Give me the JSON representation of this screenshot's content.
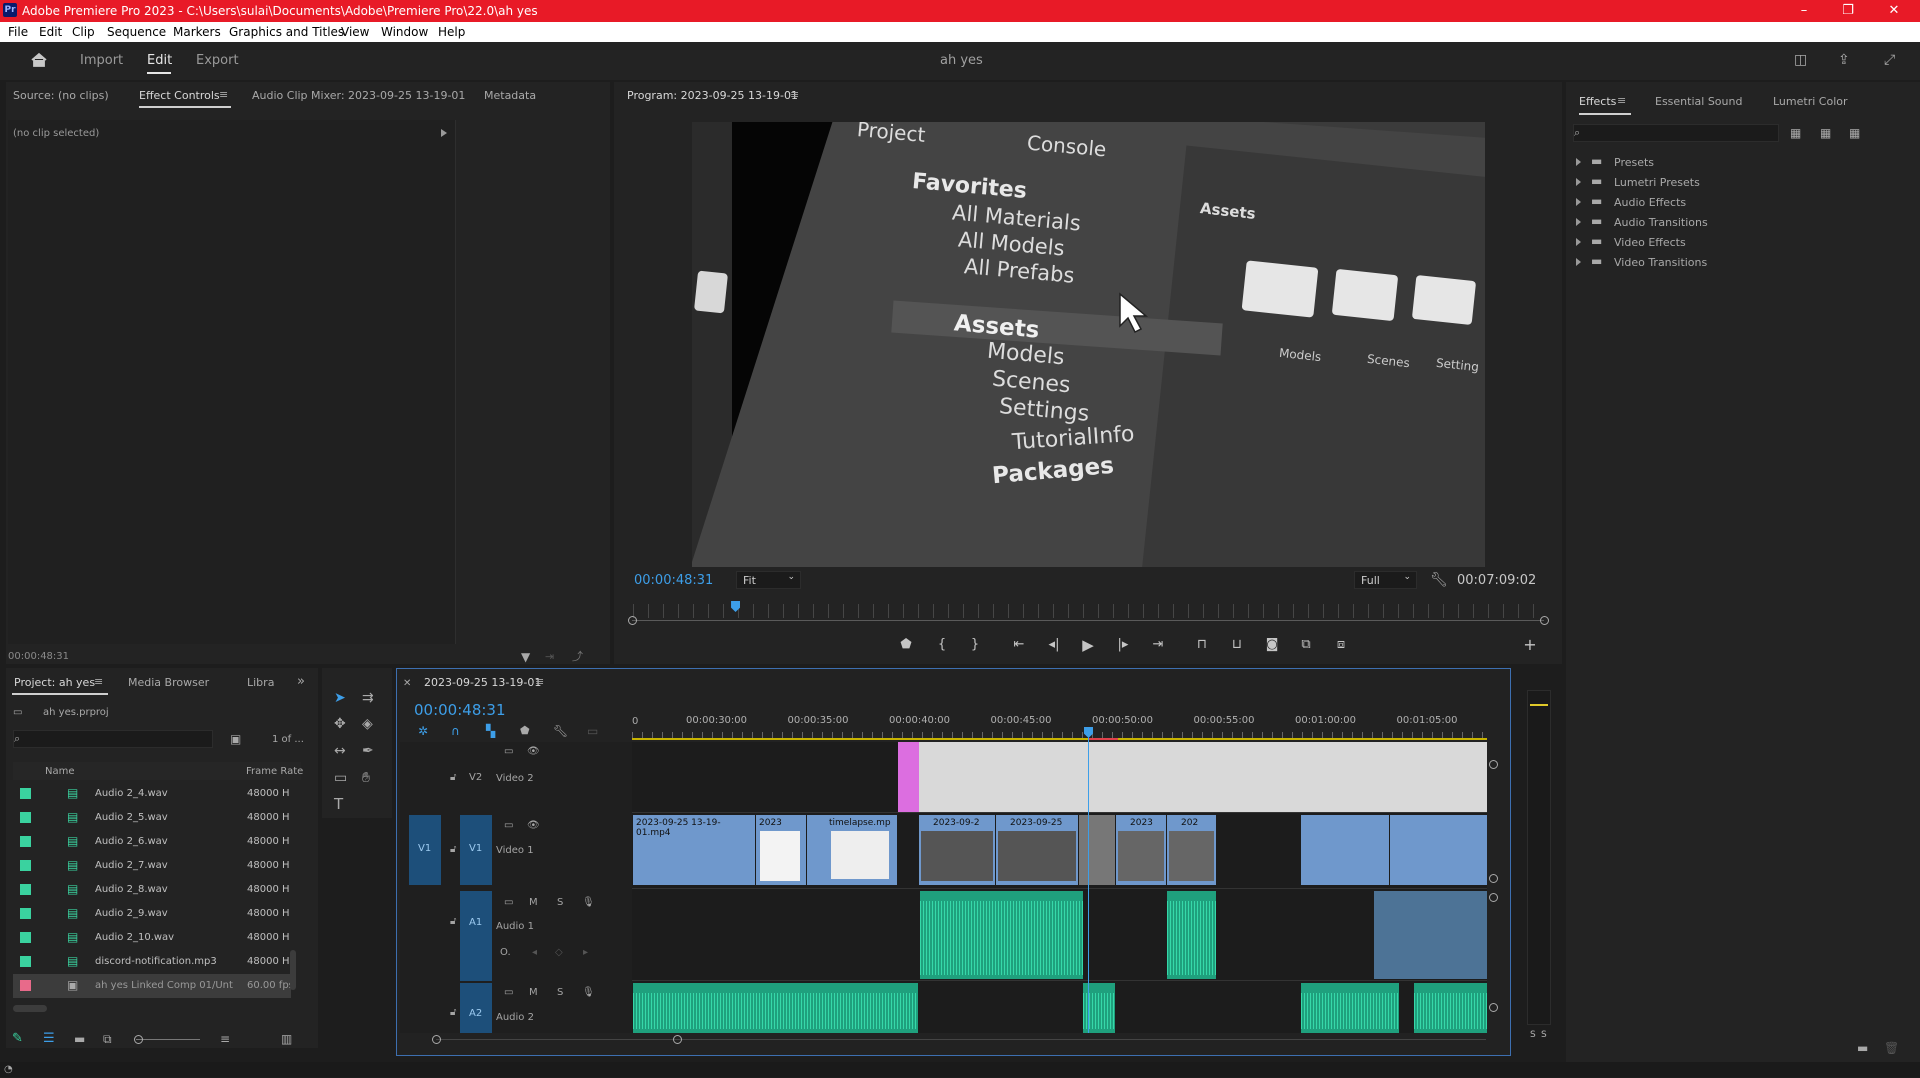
{
  "window": {
    "title": "Adobe Premiere Pro 2023 - C:\\Users\\sulai\\Documents\\Adobe\\Premiere Pro\\22.0\\ah yes",
    "app_badge": "Pr",
    "minimize": "–",
    "restore": "❐",
    "close": "✕"
  },
  "menu": [
    "File",
    "Edit",
    "Clip",
    "Sequence",
    "Markers",
    "Graphics and Titles",
    "View",
    "Window",
    "Help"
  ],
  "workspace": {
    "tabs": [
      "Import",
      "Edit",
      "Export"
    ],
    "active": "Edit",
    "project_name": "ah yes"
  },
  "source_panel": {
    "tabs": [
      "Source: (no clips)",
      "Effect Controls",
      "Audio Clip Mixer: 2023-09-25 13-19-01",
      "Metadata"
    ],
    "active": "Effect Controls",
    "no_clip": "(no clip selected)",
    "timecode": "00:00:48:31"
  },
  "program": {
    "title": "Program: 2023-09-25 13-19-01",
    "timecode": "00:00:48:31",
    "fit": "Fit",
    "quality": "Full",
    "duration": "00:07:09:02",
    "playhead_fraction": 0.113
  },
  "video_frame": {
    "labels": {
      "project": "Project",
      "console": "Console",
      "favorites": "Favorites",
      "all_materials": "All Materials",
      "all_models": "All Models",
      "all_prefabs": "All Prefabs",
      "assets": "Assets",
      "models": "Models",
      "scenes": "Scenes",
      "settings": "Settings",
      "tutorialinfo": "TutorialInfo",
      "packages": "Packages",
      "assets_header": "Assets",
      "grid_models": "Models",
      "grid_scenes": "Scenes",
      "grid_settings": "Setting"
    }
  },
  "effects_panel": {
    "tabs": [
      "Effects",
      "Essential Sound",
      "Lumetri Color"
    ],
    "active": "Effects",
    "items": [
      "Presets",
      "Lumetri Presets",
      "Audio Effects",
      "Audio Transitions",
      "Video Effects",
      "Video Transitions"
    ]
  },
  "project_panel": {
    "tabs": [
      "Project: ah yes",
      "Media Browser",
      "Libra"
    ],
    "file": "ah yes.prproj",
    "count": "1 of ...",
    "col_name": "Name",
    "col_rate": "Frame Rate",
    "items": [
      {
        "name": "Audio 2_4.wav",
        "rate": "48000 H",
        "color": "#3ad29f"
      },
      {
        "name": "Audio 2_5.wav",
        "rate": "48000 H",
        "color": "#3ad29f"
      },
      {
        "name": "Audio 2_6.wav",
        "rate": "48000 H",
        "color": "#3ad29f"
      },
      {
        "name": "Audio 2_7.wav",
        "rate": "48000 H",
        "color": "#3ad29f"
      },
      {
        "name": "Audio 2_8.wav",
        "rate": "48000 H",
        "color": "#3ad29f"
      },
      {
        "name": "Audio 2_9.wav",
        "rate": "48000 H",
        "color": "#3ad29f"
      },
      {
        "name": "Audio 2_10.wav",
        "rate": "48000 H",
        "color": "#3ad29f"
      },
      {
        "name": "discord-notification.mp3",
        "rate": "48000 H",
        "color": "#3ad29f"
      },
      {
        "name": "ah yes Linked Comp 01/Unt",
        "rate": "60.00 fps",
        "color": "#e86a8a"
      }
    ]
  },
  "timeline": {
    "sequence": "2023-09-25 13-19-01",
    "timecode": "00:00:48:31",
    "ruler": [
      "00:00:30:00",
      "00:00:35:00",
      "00:00:40:00",
      "00:00:45:00",
      "00:00:50:00",
      "00:00:55:00",
      "00:01:00:00",
      "00:01:05:00"
    ],
    "tracks": {
      "v2": "V2",
      "v2_name": "Video 2",
      "v1": "V1",
      "v1_name": "Video 1",
      "a1": "A1",
      "a1_name": "Audio 1",
      "a2": "A2",
      "a2_name": "Audio 2"
    },
    "clips": {
      "c1": "2023-09-25 13-19-01.mp4",
      "c2": "2023",
      "c3": "timelapse.mp",
      "c4": "2023-09-2",
      "c5": "2023-09-25",
      "c6": "2023",
      "c7": "202"
    },
    "mute": "M",
    "solo": "S"
  },
  "meter": {
    "labels": [
      "S",
      "S"
    ]
  }
}
